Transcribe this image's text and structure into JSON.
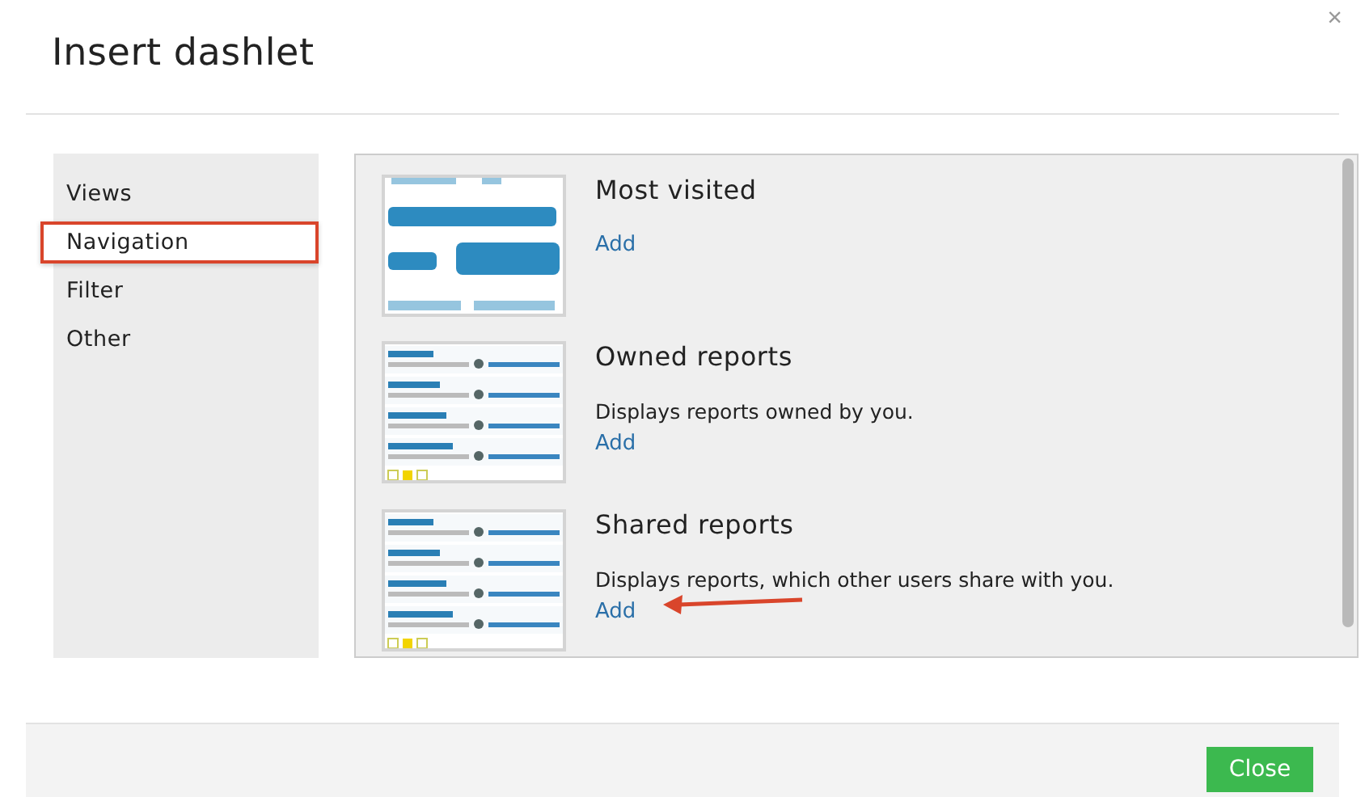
{
  "dialog": {
    "title": "Insert dashlet",
    "close": "×"
  },
  "sidebar": {
    "items": [
      {
        "label": "Views",
        "selected": false
      },
      {
        "label": "Navigation",
        "selected": true
      },
      {
        "label": "Filter",
        "selected": false
      },
      {
        "label": "Other",
        "selected": false
      }
    ]
  },
  "dashlets": [
    {
      "kind": "cloud",
      "title": "Most visited",
      "add": "Add"
    },
    {
      "kind": "list",
      "title": "Owned reports",
      "description": "Displays reports owned by you.",
      "add": "Add"
    },
    {
      "kind": "list",
      "title": "Shared reports",
      "description": "Displays reports, which other users share with you.",
      "add": "Add",
      "pointer": true
    }
  ],
  "footer": {
    "close_button": "Close"
  }
}
